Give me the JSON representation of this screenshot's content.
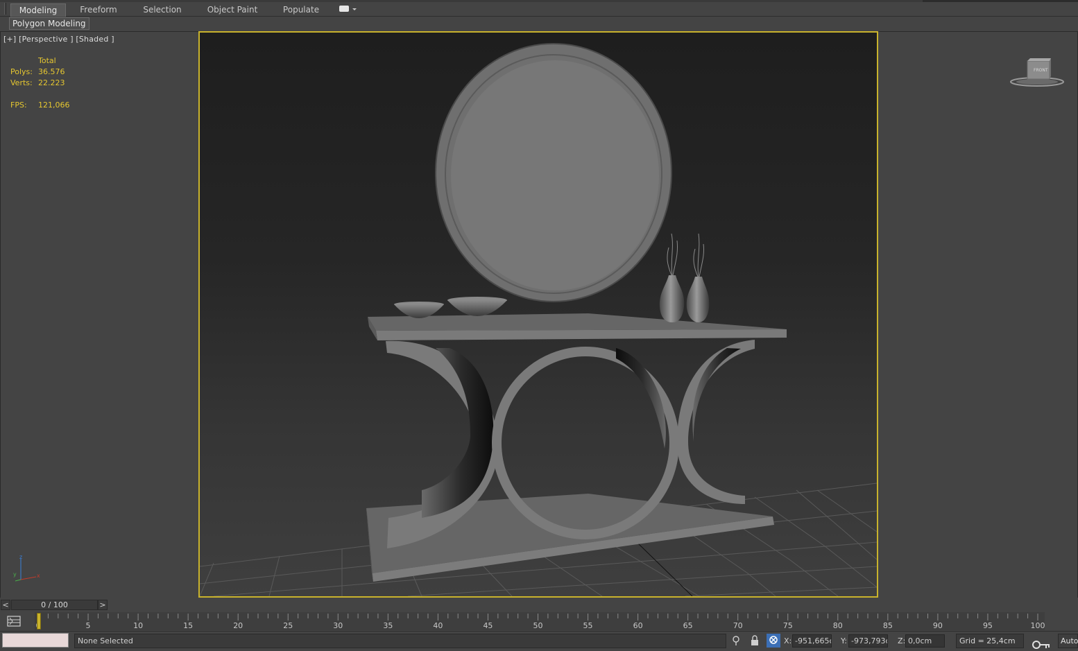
{
  "ribbon": {
    "tabs": [
      {
        "label": "Modeling",
        "active": true
      },
      {
        "label": "Freeform",
        "active": false
      },
      {
        "label": "Selection",
        "active": false
      },
      {
        "label": "Object Paint",
        "active": false
      },
      {
        "label": "Populate",
        "active": false
      }
    ],
    "more_icon": "ribbon-options-icon",
    "panel": "Polygon Modeling"
  },
  "viewport": {
    "label": "[+] [Perspective ] [Shaded ]",
    "stats": {
      "header": "Total",
      "polys_label": "Polys:",
      "polys": "36.576",
      "verts_label": "Verts:",
      "verts": "22.223",
      "fps_label": "FPS:",
      "fps": "121,066"
    },
    "viewcube_label": "FRONT",
    "border_color": "#c9b32c"
  },
  "time_slider": {
    "prev": "<",
    "next": ">",
    "value": "0 / 100",
    "ticks": [
      "0",
      "5",
      "10",
      "15",
      "20",
      "25",
      "30",
      "35",
      "40",
      "45",
      "50",
      "55",
      "60",
      "65",
      "70",
      "75",
      "80",
      "85",
      "90",
      "95",
      "100"
    ]
  },
  "status": {
    "selection": "None Selected",
    "x_label": "X:",
    "x_value": "-951,665cm",
    "y_label": "Y:",
    "y_value": "-973,793cm",
    "z_label": "Z:",
    "z_value": "0,0cm",
    "grid": "Grid = 25,4cm",
    "auto_key": "Auto"
  },
  "colors": {
    "accent": "#c9b32c",
    "stats_text": "#e6c730",
    "selection_lock": "#3b6fb6"
  }
}
